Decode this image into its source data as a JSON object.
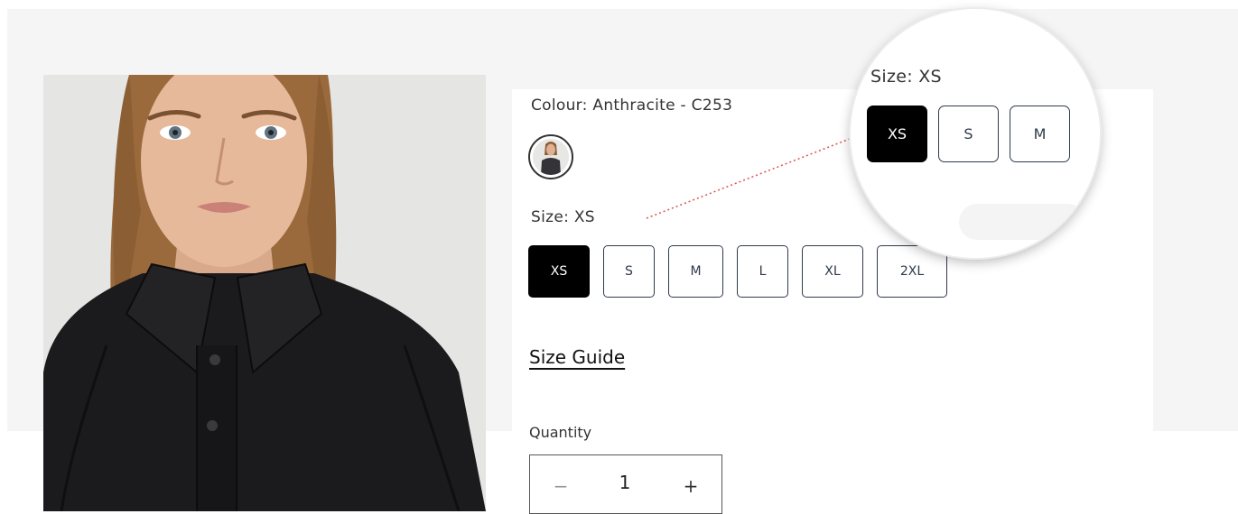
{
  "product": {
    "colour_label": "Colour: Anthracite - C253",
    "size_label": "Size: XS",
    "sizes": [
      {
        "label": "XS",
        "selected": true
      },
      {
        "label": "S",
        "selected": false
      },
      {
        "label": "M",
        "selected": false
      },
      {
        "label": "L",
        "selected": false
      },
      {
        "label": "XL",
        "selected": false
      },
      {
        "label": "2XL",
        "selected": false
      }
    ],
    "size_guide": "Size Guide",
    "quantity_label": "Quantity",
    "quantity_value": "1",
    "minus_symbol": "−",
    "plus_symbol": "+"
  },
  "magnifier": {
    "size_label": "Size: XS",
    "sizes": [
      "XS",
      "S",
      "M"
    ]
  },
  "colors": {
    "selected_bg": "#000000",
    "button_border": "#2f3a4a",
    "leader_line": "#d9534f",
    "garment": "#1b1b1d"
  }
}
